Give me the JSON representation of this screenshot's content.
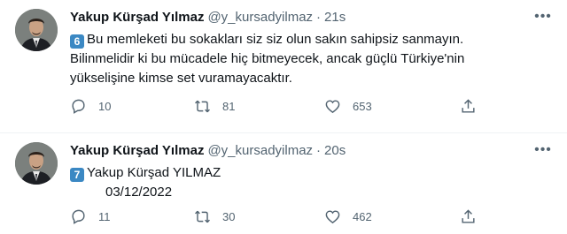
{
  "tweets": [
    {
      "author": {
        "name": "Yakup Kürşad Yılmaz",
        "handle": "@y_kursadyilmaz"
      },
      "separator": "·",
      "time": "21s",
      "badge": "6",
      "lines": [
        "Bu memleketi bu sokakları siz siz olun sakın sahipsiz sanmayın.",
        "Bilinmelidir ki bu mücadele hiç bitmeyecek, ancak güçlü Türkiye'nin",
        "yükselişine kimse set vuramayacaktır."
      ],
      "stats": {
        "replies": "10",
        "retweets": "81",
        "likes": "653"
      }
    },
    {
      "author": {
        "name": "Yakup Kürşad Yılmaz",
        "handle": "@y_kursadyilmaz"
      },
      "separator": "·",
      "time": "20s",
      "badge": "7",
      "lines": [
        "Yakup Kürşad YILMAZ",
        "03/12/2022"
      ],
      "stats": {
        "replies": "11",
        "retweets": "30",
        "likes": "462"
      }
    }
  ],
  "icons": {
    "reply": "reply-icon",
    "retweet": "retweet-icon",
    "like": "like-icon",
    "share": "share-icon",
    "more": "more-icon"
  },
  "colors": {
    "text": "#0f1419",
    "secondary": "#536471",
    "keycap": "#3b88c3",
    "divider": "#eff3f4"
  }
}
